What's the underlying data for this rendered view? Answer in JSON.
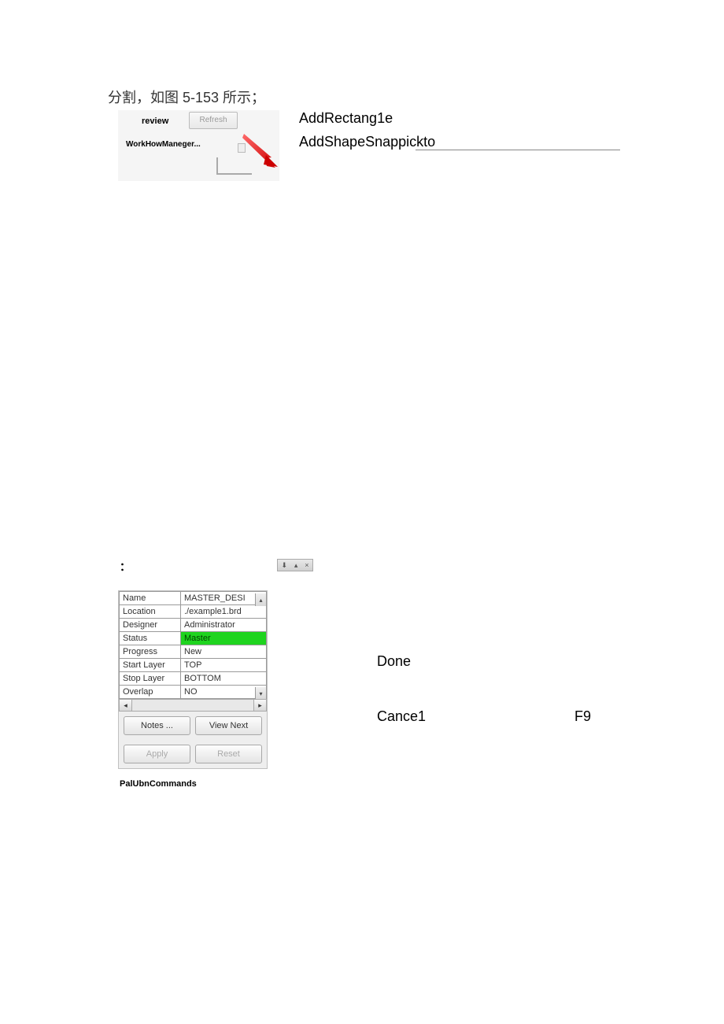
{
  "topText": "分割，如图 5-153 所示；",
  "snippet": {
    "reviewLabel": "review",
    "refreshLabel": "Refresh",
    "workflowLabel": "WorkHowManeger..."
  },
  "rightText": {
    "addRect": "AddRectang1e",
    "addShape": "AddShapeSnappickto"
  },
  "colon": "：",
  "titlebar": {
    "pin": "⬇",
    "up": "▴",
    "close": "×"
  },
  "panel": {
    "rows": [
      {
        "key": "Name",
        "val": "MASTER_DESI",
        "scroll": "▴"
      },
      {
        "key": "Location",
        "val": "./example1.brd"
      },
      {
        "key": "Designer",
        "val": "Administrator"
      },
      {
        "key": "Status",
        "val": "Master",
        "green": true
      },
      {
        "key": "Progress",
        "val": "New"
      },
      {
        "key": "Start Layer",
        "val": "TOP"
      },
      {
        "key": "Stop Layer",
        "val": "BOTTOM"
      },
      {
        "key": "Overlap",
        "val": "NO",
        "scroll": "▾"
      }
    ],
    "hscroll": {
      "left": "◂",
      "right": "▸"
    },
    "buttons": {
      "notes": "Notes ...",
      "viewNext": "View Next",
      "apply": "Apply",
      "reset": "Reset"
    }
  },
  "palLabel": "PalUbnCommands",
  "menu": {
    "done": "Done",
    "cancel": "Cance1",
    "f9": "F9"
  }
}
